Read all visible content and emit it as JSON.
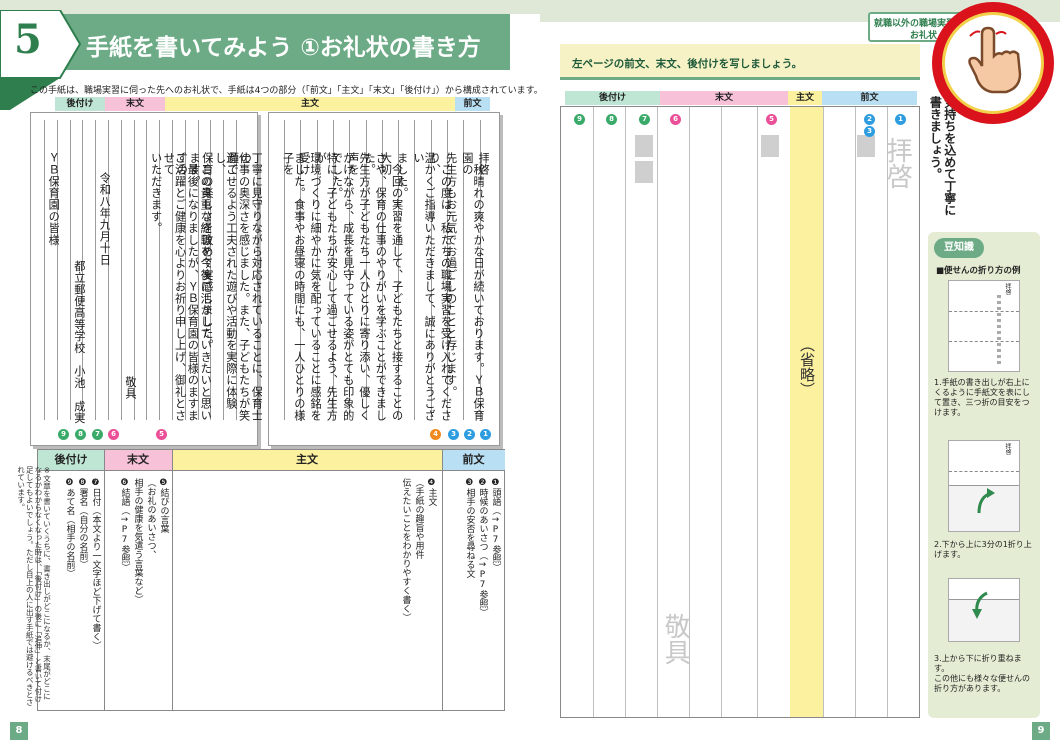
{
  "header": {
    "chapter_number": "5",
    "title": "手紙を書いてみよう ①お礼状の書き方",
    "top_label_line1": "就職以外の職場実習先",
    "top_label_line2": "お礼状"
  },
  "guide_text": "この手紙は、職場実習に伺った先へのお礼状で、手紙は4つの部分（「前文」「主文」「末文」「後付け」）から構成されています。",
  "sections": {
    "atozuke": "後付け",
    "matsubun": "末文",
    "shubun": "主文",
    "zenbun": "前文"
  },
  "letter_right": {
    "lines": [
      "拝啓",
      "　秋晴れの爽やかな日が続いております。ＹＢ保育園の",
      "先生方もお元気でお過ごしのことと存じます。",
      "　この度は、私たちの職場実習を受け入れてくださり、",
      "温かくご指導いただきまして、誠にありがとうござい",
      "ました。",
      "　今回の実習を通して、子どもたちと接することの大切",
      "さや、保育の仕事のやりがいを学ぶことができました。",
      "先生方が子どもたち一人ひとりに寄り添い、優しく声を",
      "かけながら、成長を見守っている姿がとても印象的でした。",
      "特に、子どもたちが安心して過ごせるよう、先生方が",
      "環境づくりに細やかに気を配っていることに感銘を受け",
      "ました。食事やお昼寝の時間にも、一人ひとりの様子を"
    ]
  },
  "letter_left": {
    "lines": [
      "丁寧に見守りながら対応されていることに、保育士の",
      "仕事の奥深さを感じました。また、子どもたちが笑顔で",
      "過ごせるよう工夫された遊びや活動を実際に体験し、",
      "保育の楽しさを改めて実感しました。",
      "　この貴重な経験を今後に活かしていきたいと思います。",
      "　最後になりましたが、ＹＢ保育園の皆様のますますの",
      "ご活躍とご健康を心よりお祈り申し上げ、御礼とさせて",
      "いただきます。",
      "",
      "敬具",
      "",
      "令和八年九月十日",
      "",
      "都立郵便高等学校　小池　成実",
      "",
      "ＹＢ保育園の皆様"
    ]
  },
  "table": {
    "zenbun_items": [
      "❶頭語（→P7参照）",
      "❷時候のあいさつ（→P7参照）",
      "❸相手の安否を尋ねる文"
    ],
    "shubun_items": [
      "❹主文",
      "（手紙の趣旨や用件",
      "伝えたいことをわかりやすく書く）"
    ],
    "matsubun_items": [
      "❺結びの言葉",
      "（お礼のあいさつ、",
      "相手の健康を気遣う言葉など）",
      "❻結語（→P7参照）"
    ],
    "atozuke_items": [
      "❼日付（本文より一文字ほど下げて書く）",
      "❽署名（自分の名前）",
      "❾あて名（相手の名前）"
    ],
    "note": "※文章を書いていくうちに、書き出しがどこになるか、末尾がどこになるかわからなくなった時は、「後付け」の後に「追伸」と書いて付け足してもよいでしょう。ただし目上の人に出す手紙では避けるべきとされています。"
  },
  "right_page": {
    "instruction": "左ページの前文、末文、後付けを写しましょう。",
    "ghost_haikei": "拝啓",
    "ghost_keigu": "敬具",
    "omitted": "（省略）",
    "side_text": "気持ちを込めて丁寧に書きましょう。"
  },
  "sidebar": {
    "badge": "豆知識",
    "title": "■便せんの折り方の例",
    "step1": "1.手紙の書き出しが右上にくるように手紙文を表にして置き、三つ折の目安をつけます。",
    "step2": "2.下から上に3分の1折り上げます。",
    "step3": "3.上から下に折り重ねます。",
    "outro": "この他にも様々な便せんの折り方があります。",
    "mini_haikei": "拝啓"
  },
  "numbers": {
    "n1": "1",
    "n2": "2",
    "n3": "3",
    "n4": "4",
    "n5": "5",
    "n6": "6",
    "n7": "7",
    "n8": "8",
    "n9": "9"
  },
  "page_numbers": {
    "left": "8",
    "right": "9"
  },
  "colors": {
    "accent_green": "#6cab86",
    "label_green": "#bfe5d4",
    "label_pink": "#f7c1d8",
    "label_yellow": "#fbf19e",
    "label_blue": "#b8dff3",
    "hand_red": "#d9121c"
  },
  "icons": {
    "hand": "pointing-hand-icon",
    "arrow_up": "curved-arrow-up-icon",
    "arrow_down": "curved-arrow-down-icon"
  }
}
